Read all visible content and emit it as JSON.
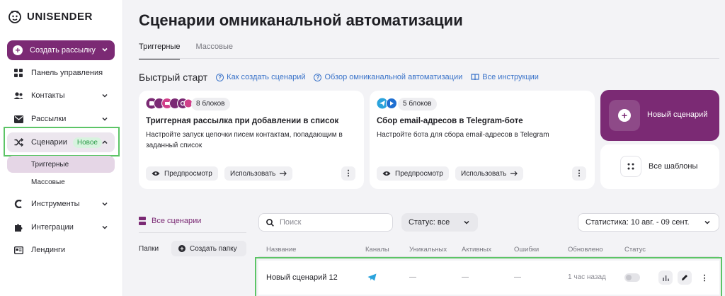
{
  "brand": {
    "name": "UNISENDER",
    "accent": "#7b2a74"
  },
  "sidebar": {
    "create_label": "Создать рассылку",
    "items": [
      {
        "label": "Панель управления",
        "icon": "dashboard-icon"
      },
      {
        "label": "Контакты",
        "icon": "contacts-icon"
      },
      {
        "label": "Рассылки",
        "icon": "mailings-icon"
      },
      {
        "label": "Сценарии",
        "icon": "shuffle-icon",
        "badge": "Новое"
      },
      {
        "label": "Триггерные"
      },
      {
        "label": "Массовые"
      },
      {
        "label": "Инструменты",
        "icon": "tools-icon"
      },
      {
        "label": "Интеграции",
        "icon": "puzzle-icon"
      },
      {
        "label": "Лендинги",
        "icon": "landing-icon"
      }
    ]
  },
  "page": {
    "title": "Сценарии омниканальной автоматизации",
    "tabs": [
      "Триггерные",
      "Массовые"
    ]
  },
  "quick_start": {
    "title": "Быстрый старт",
    "links": [
      "Как создать сценарий",
      "Обзор омниканальной автоматизации",
      "Все инструкции"
    ]
  },
  "cards": [
    {
      "chip": "8 блоков",
      "title": "Триггерная рассылка при добавлении в список",
      "desc": "Настройте запуск цепочки писем контактам, попадающим в заданный список",
      "preview": "Предпросмотр",
      "use": "Использовать"
    },
    {
      "chip": "5 блоков",
      "title": "Сбор email-адресов в Telegram-боте",
      "desc": "Настройте бота для сбора email-адресов в Telegram",
      "preview": "Предпросмотр",
      "use": "Использовать"
    }
  ],
  "new_scenario": "Новый сценарий",
  "all_templates": "Все шаблоны",
  "list": {
    "all_scenarios": "Все сценарии",
    "folders": "Папки",
    "create_folder": "Создать папку",
    "search_placeholder": "Поиск",
    "status_filter": "Статус: все",
    "stats_filter": "Статистика: 10 авг. - 09 сент.",
    "columns": [
      "Название",
      "Каналы",
      "Уникальных",
      "Активных",
      "Ошибки",
      "Обновлено",
      "Статус"
    ],
    "rows": [
      {
        "name": "Новый сценарий 12",
        "unique": "—",
        "active": "—",
        "errors": "—",
        "updated": "1 час назад"
      }
    ]
  }
}
